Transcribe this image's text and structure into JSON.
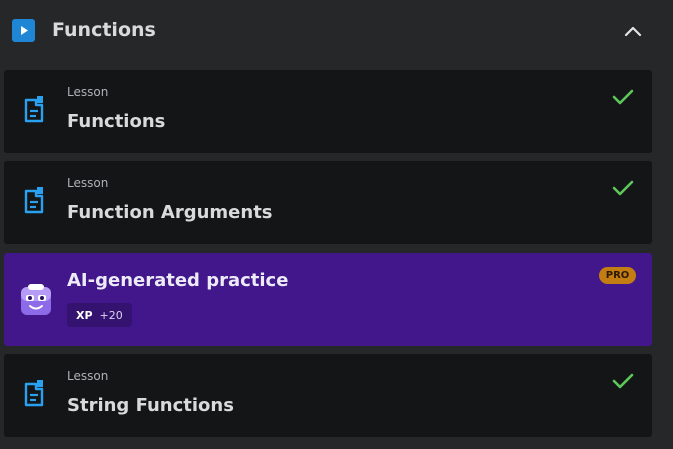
{
  "section": {
    "title": "Functions",
    "icon": "play-icon",
    "toggle_icon": "chevron-up-icon"
  },
  "items": [
    {
      "type_label": "Lesson",
      "title": "Functions",
      "completed": true,
      "icon": "document-icon"
    },
    {
      "type_label": "Lesson",
      "title": "Function Arguments",
      "completed": true,
      "icon": "document-icon"
    },
    {
      "title": "AI-generated practice",
      "xp_label": "XP",
      "xp_value": "+20",
      "badge": "PRO",
      "icon": "robot-avatar-icon"
    },
    {
      "type_label": "Lesson",
      "title": "String Functions",
      "completed": true,
      "icon": "document-icon"
    }
  ],
  "colors": {
    "background": "#262728",
    "card": "#141517",
    "practice_card": "#41178b",
    "accent_blue": "#1f86d6",
    "check_green": "#5ec75a",
    "pro_badge": "#c47d12"
  }
}
